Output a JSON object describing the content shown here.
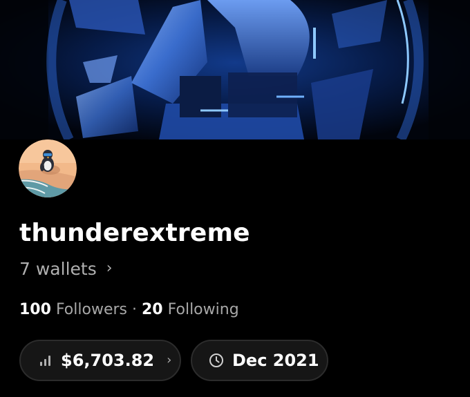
{
  "profile": {
    "username": "thunderextreme",
    "wallets_label": "7 wallets",
    "followers_count": "100",
    "followers_label": "Followers",
    "separator": "·",
    "following_count": "20",
    "following_label": "Following"
  },
  "stats": {
    "balance": "$6,703.82",
    "joined": "Dec 2021"
  },
  "icons": {
    "wallets_chevron": "chevron-right-icon",
    "balance": "bar-chart-icon",
    "balance_chevron": "chevron-right-icon",
    "joined": "clock-icon"
  },
  "colors": {
    "background": "#000000",
    "secondary_text": "#a8a8a8",
    "pill_background": "#161616",
    "banner_accent": "#3a8cff"
  }
}
